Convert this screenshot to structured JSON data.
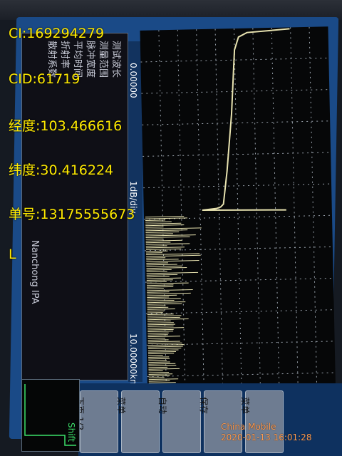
{
  "overlay": {
    "ci": "CI:169294279",
    "cid": "CID:61719",
    "longitude": "经度:103.466616",
    "latitude": "纬度:30.416224",
    "order_no": "单号:13175555673",
    "letter": "L"
  },
  "watermark": {
    "carrier": "China Mobile",
    "timestamp": "2020-01-13 16:01:28"
  },
  "screen": {
    "x_start": "0.00000",
    "x_end": "10.00000km",
    "scale": "1dB/div",
    "brand": "Nanchong IPA",
    "left_rows": [
      "测试波长",
      "测量范围",
      "脉冲宽度",
      "平均时间",
      "折射率",
      "散射系数"
    ],
    "softkeys": [
      "下页 1/2",
      "菜单",
      "自动",
      "保存",
      "菜单"
    ],
    "mini_label": "Shift"
  },
  "colors": {
    "overlay_text": "#ffea00",
    "trace": "#e8e3b0",
    "screen_blue": "#1a4a87"
  }
}
